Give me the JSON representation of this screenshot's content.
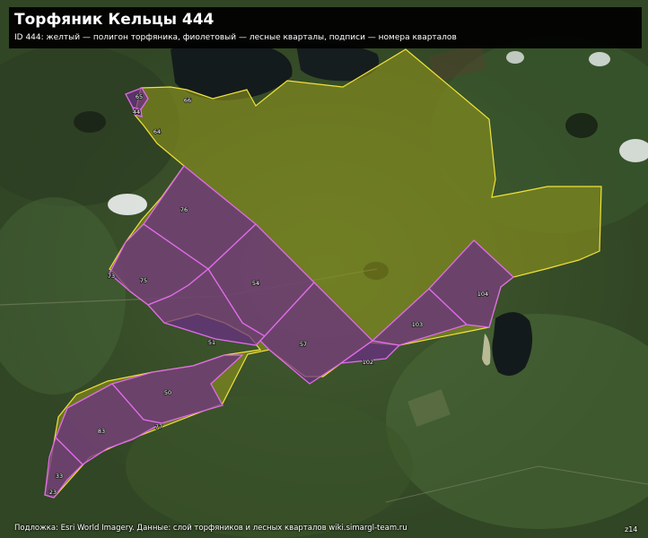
{
  "map": {
    "title": "Торфяник Кельцы 444",
    "subtitle": "ID 444: желтый — полигон торфяника, фиолетовый — лесные кварталы, подписи — номера кварталов",
    "attribution": "Подложка: Esri World Imagery. Данные: слой торфяников и лесных кварталов wiki.simargl-team.ru",
    "scale_corner_label": "z14",
    "colors": {
      "peat_fill": "#8a8f1e",
      "peat_outline": "#f2e23a",
      "quarter_fill": "#6b2e86",
      "quarter_outline": "#e06ce8"
    },
    "peat_polygon": {
      "name": "Торфяник Кельцы",
      "id": "444"
    },
    "quarter_labels": [
      "65",
      "44",
      "66",
      "64",
      "76",
      "73",
      "75",
      "54",
      "51",
      "57",
      "102",
      "103",
      "104",
      "50",
      "83",
      "77",
      "33",
      "23"
    ]
  }
}
